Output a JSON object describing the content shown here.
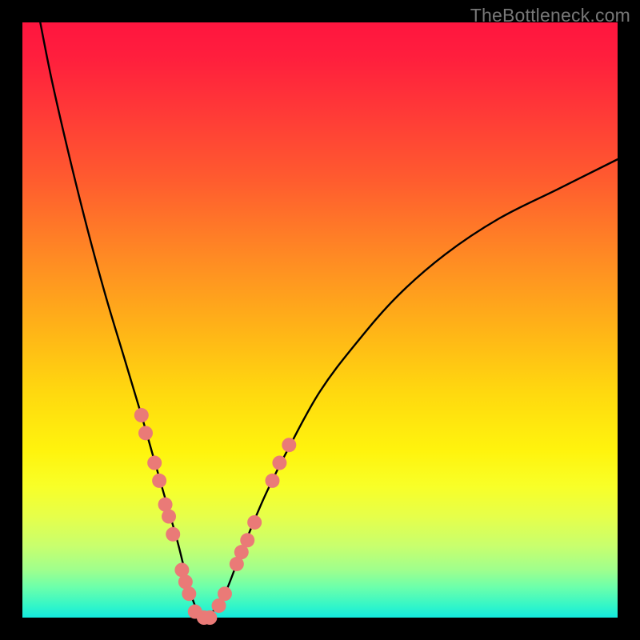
{
  "watermark": "TheBottleneck.com",
  "colors": {
    "background_black": "#000000",
    "curve_stroke": "#000000",
    "dot_fill": "#ea7a77",
    "dot_stroke": "#d85e5b",
    "gradient_top": "#ff153f",
    "gradient_bottom": "#14e9dd"
  },
  "chart_data": {
    "type": "line",
    "title": "",
    "xlabel": "",
    "ylabel": "",
    "xlim": [
      0,
      100
    ],
    "ylim": [
      0,
      100
    ],
    "grid": false,
    "legend": false,
    "series": [
      {
        "name": "bottleneck-curve",
        "x": [
          3,
          5,
          8,
          11,
          14,
          17,
          20,
          22,
          24,
          26,
          27,
          28,
          29,
          30,
          31,
          32,
          34,
          36,
          38,
          41,
          45,
          50,
          56,
          63,
          71,
          80,
          90,
          100
        ],
        "y": [
          100,
          90,
          77,
          65,
          54,
          44,
          34,
          27,
          20,
          13,
          9,
          5,
          2,
          0,
          0,
          1,
          4,
          9,
          14,
          21,
          29,
          38,
          46,
          54,
          61,
          67,
          72,
          77
        ]
      }
    ],
    "annotations": {
      "scatter_dots": [
        {
          "x": 20.0,
          "y": 34
        },
        {
          "x": 20.7,
          "y": 31
        },
        {
          "x": 22.2,
          "y": 26
        },
        {
          "x": 23.0,
          "y": 23
        },
        {
          "x": 24.0,
          "y": 19
        },
        {
          "x": 24.6,
          "y": 17
        },
        {
          "x": 25.3,
          "y": 14
        },
        {
          "x": 26.8,
          "y": 8
        },
        {
          "x": 27.4,
          "y": 6
        },
        {
          "x": 28.0,
          "y": 4
        },
        {
          "x": 29.0,
          "y": 1
        },
        {
          "x": 30.5,
          "y": 0
        },
        {
          "x": 31.5,
          "y": 0
        },
        {
          "x": 33.0,
          "y": 2
        },
        {
          "x": 34.0,
          "y": 4
        },
        {
          "x": 36.0,
          "y": 9
        },
        {
          "x": 36.8,
          "y": 11
        },
        {
          "x": 37.8,
          "y": 13
        },
        {
          "x": 39.0,
          "y": 16
        },
        {
          "x": 42.0,
          "y": 23
        },
        {
          "x": 43.2,
          "y": 26
        },
        {
          "x": 44.8,
          "y": 29
        }
      ]
    }
  }
}
